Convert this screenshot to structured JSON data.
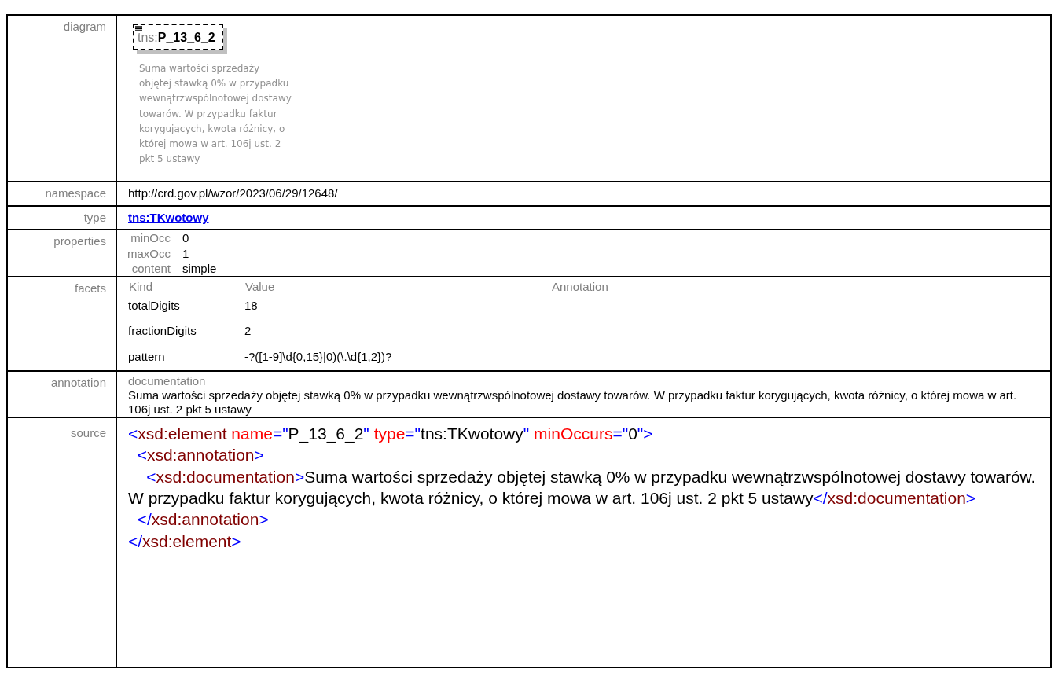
{
  "rows": [
    {
      "kind": "diagram",
      "label": "diagram",
      "prefix": "tns:",
      "name": "P_13_6_2",
      "description": "Suma wartości sprzedaży objętej stawką 0% w przypadku wewnątrzwspólnotowej dostawy towarów. W przypadku faktur korygujących, kwota różnicy, o której mowa w art. 106j ust. 2 pkt 5 ustawy"
    },
    {
      "kind": "text",
      "label": "namespace",
      "value": "http://crd.gov.pl/wzor/2023/06/29/12648/"
    },
    {
      "kind": "link",
      "label": "type",
      "value": "tns:TKwotowy"
    },
    {
      "kind": "properties",
      "label": "properties",
      "items": [
        {
          "name": "minOcc",
          "value": "0"
        },
        {
          "name": "maxOcc",
          "value": "1"
        },
        {
          "name": "content",
          "value": "simple"
        }
      ]
    },
    {
      "kind": "facets",
      "label": "facets",
      "columns": [
        "Kind",
        "Value",
        "Annotation"
      ],
      "items": [
        {
          "kind": "totalDigits",
          "value": "18"
        },
        {
          "kind": "fractionDigits",
          "value": "2"
        },
        {
          "kind": "pattern",
          "value": "-?([1-9]\\d{0,15}|0)(\\.\\d{1,2})?"
        }
      ]
    },
    {
      "kind": "annotation",
      "label": "annotation",
      "heading": "documentation",
      "value": "Suma wartości sprzedaży objętej stawką 0% w przypadku wewnątrzwspólnotowej dostawy towarów. W przypadku faktur korygujących, kwota różnicy, o której mowa w art. 106j ust. 2 pkt 5 ustawy"
    },
    {
      "kind": "source",
      "label": "source",
      "lines": [
        [
          {
            "t": "<",
            "kind": "punct"
          },
          {
            "t": "xsd:element",
            "kind": "tag"
          },
          {
            "t": " name",
            "kind": "attr"
          },
          {
            "t": "=\"",
            "kind": "punct"
          },
          {
            "t": "P_13_6_2",
            "kind": "value"
          },
          {
            "t": "\"",
            "kind": "punct"
          },
          {
            "t": " type",
            "kind": "attr"
          },
          {
            "t": "=\"",
            "kind": "punct"
          },
          {
            "t": "tns:TKwotowy",
            "kind": "value"
          },
          {
            "t": "\"",
            "kind": "punct"
          },
          {
            "t": " minOccurs",
            "kind": "attr"
          },
          {
            "t": "=\"",
            "kind": "punct"
          },
          {
            "t": "0",
            "kind": "value"
          },
          {
            "t": "\">",
            "kind": "punct"
          }
        ],
        [
          {
            "t": "  <",
            "kind": "punct"
          },
          {
            "t": "xsd:annotation",
            "kind": "tag"
          },
          {
            "t": ">",
            "kind": "punct"
          }
        ],
        [
          {
            "t": "    <",
            "kind": "punct"
          },
          {
            "t": "xsd:documentation",
            "kind": "tag"
          },
          {
            "t": ">",
            "kind": "punct"
          },
          {
            "t": "Suma wartości sprzedaży objętej stawką 0% w przypadku wewnątrzwspólnotowej dostawy towarów. W przypadku faktur korygujących, kwota różnicy, o której mowa w art. 106j ust. 2 pkt 5 ustawy",
            "kind": "value"
          },
          {
            "t": "</",
            "kind": "punct"
          },
          {
            "t": "xsd:documentation",
            "kind": "tag"
          },
          {
            "t": ">",
            "kind": "punct"
          }
        ],
        [
          {
            "t": "  </",
            "kind": "punct"
          },
          {
            "t": "xsd:annotation",
            "kind": "tag"
          },
          {
            "t": ">",
            "kind": "punct"
          }
        ],
        [
          {
            "t": "</",
            "kind": "punct"
          },
          {
            "t": "xsd:element",
            "kind": "tag"
          },
          {
            "t": ">",
            "kind": "punct"
          }
        ]
      ]
    }
  ]
}
